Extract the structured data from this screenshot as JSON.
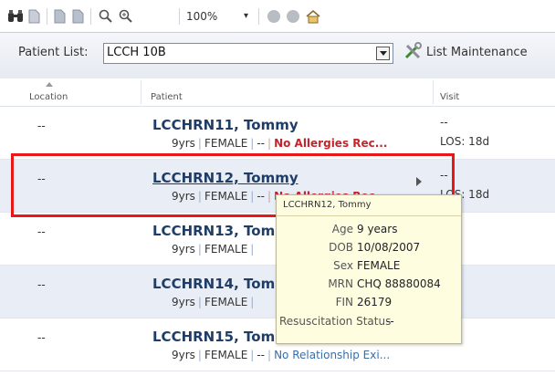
{
  "toolbar": {
    "zoom": "100%",
    "icons": [
      "binoculars-icon",
      "document-icon",
      "print-icon",
      "print-preview-icon",
      "zoom-out-icon",
      "zoom-in-icon",
      "back-icon",
      "forward-icon",
      "home-icon"
    ]
  },
  "patient_list": {
    "label": "Patient List:",
    "value": "LCCH 10B",
    "maintenance_label": "List Maintenance"
  },
  "columns": {
    "location": "Location",
    "patient": "Patient",
    "visit": "Visit"
  },
  "patients": [
    {
      "location": "--",
      "name": "LCCHRN11, Tommy",
      "age": "9yrs",
      "sex": "FEMALE",
      "dash": "--",
      "flag": "No Allergies Rec...",
      "flag_type": "allergy",
      "visit_line1": "--",
      "visit_line2": "LOS: 18d"
    },
    {
      "location": "--",
      "name": "LCCHRN12, Tommy",
      "age": "9yrs",
      "sex": "FEMALE",
      "dash": "--",
      "flag": "No Allergies Rec...",
      "flag_type": "allergy",
      "visit_line1": "--",
      "visit_line2": "LOS: 18d"
    },
    {
      "location": "--",
      "name": "LCCHRN13, Tommy",
      "age": "9yrs",
      "sex": "FEMALE",
      "dash": "",
      "flag": "",
      "flag_type": "",
      "visit_line1": "",
      "visit_line2": ""
    },
    {
      "location": "--",
      "name": "LCCHRN14, Tommy",
      "age": "9yrs",
      "sex": "FEMALE",
      "dash": "",
      "flag": "",
      "flag_type": "",
      "visit_line1": "",
      "visit_line2": ""
    },
    {
      "location": "--",
      "name": "LCCHRN15, Tommy",
      "age": "9yrs",
      "sex": "FEMALE",
      "dash": "--",
      "flag": "No Relationship Exi...",
      "flag_type": "relationship",
      "visit_line1": "",
      "visit_line2": ""
    }
  ],
  "tooltip": {
    "title": "LCCHRN12, Tommy",
    "fields": [
      {
        "key": "Age",
        "value": "9 years"
      },
      {
        "key": "DOB",
        "value": "10/08/2007"
      },
      {
        "key": "Sex",
        "value": "FEMALE"
      },
      {
        "key": "MRN",
        "value": "CHQ 88880084"
      },
      {
        "key": "FIN",
        "value": "26179"
      }
    ],
    "resus_key": "Resuscitation Status",
    "resus_value": "--"
  },
  "colors": {
    "patient_name": "#1f3d66",
    "allergy_alert": "#c0262c",
    "highlight_box": "#e81818",
    "tooltip_bg": "#fffde0"
  }
}
